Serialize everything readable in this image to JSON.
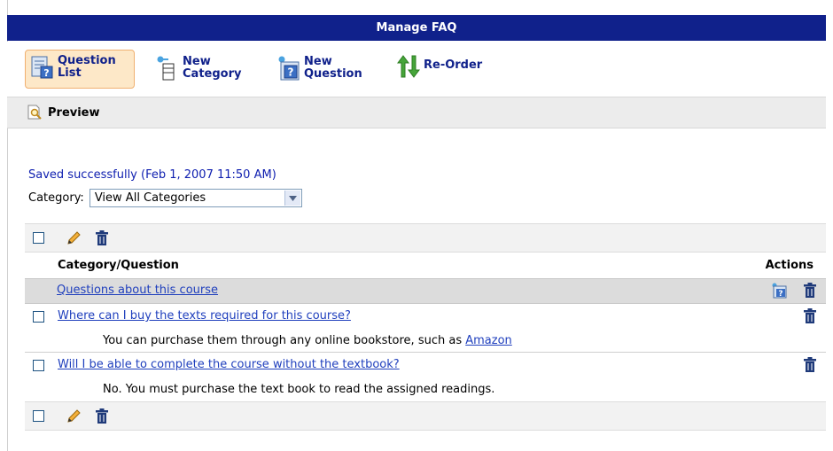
{
  "header": {
    "title": "Manage FAQ"
  },
  "toolbar": {
    "question_list": {
      "line1": "Question",
      "line2": "List"
    },
    "new_category": {
      "line1": "New",
      "line2": "Category"
    },
    "new_question": {
      "line1": "New",
      "line2": "Question"
    },
    "reorder": {
      "label": "Re-Order"
    }
  },
  "preview": {
    "label": "Preview"
  },
  "status": {
    "message": "Saved successfully (Feb 1, 2007 11:50 AM)"
  },
  "filter": {
    "label": "Category:",
    "selected": "View All Categories"
  },
  "table": {
    "col_question": "Category/Question",
    "col_actions": "Actions",
    "category": {
      "label": "Questions about this course"
    },
    "questions": [
      {
        "question": "Where can I buy the texts required for this course?",
        "answer_prefix": "You can purchase them through any online bookstore, such as ",
        "answer_link": "Amazon"
      },
      {
        "question": "Will I be able to complete the course without the textbook?",
        "answer": "No. You must purchase the text book to read the assigned readings."
      }
    ]
  },
  "colors": {
    "header_bg": "#10218b",
    "link": "#1f3fbd",
    "status": "#1020b0",
    "active_button_bg": "#fde8c8"
  }
}
